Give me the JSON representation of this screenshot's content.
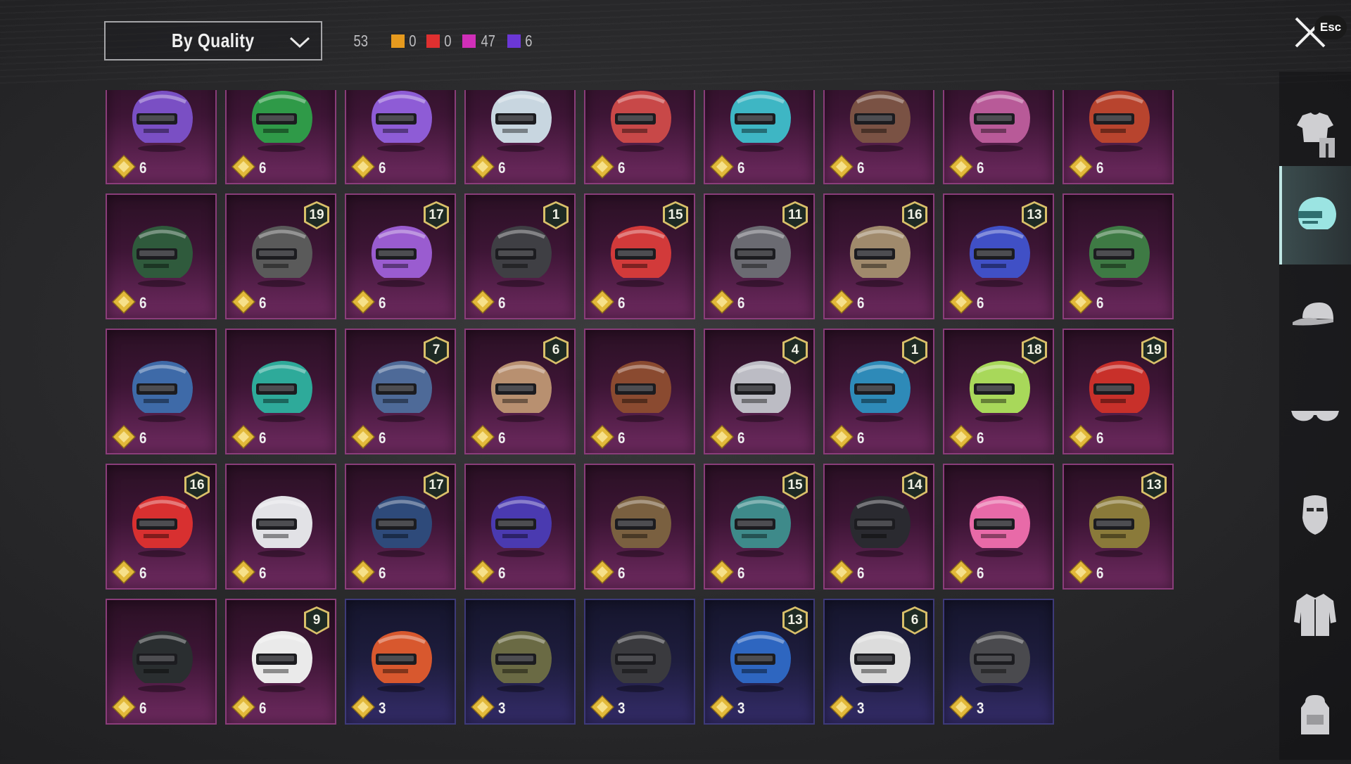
{
  "sort": {
    "label": "By Quality"
  },
  "counts": {
    "total": "53",
    "items": [
      {
        "color": "#e69a1e",
        "value": "0"
      },
      {
        "color": "#e03030",
        "value": "0"
      },
      {
        "color": "#d02fb8",
        "value": "47"
      },
      {
        "color": "#6b37d6",
        "value": "6"
      }
    ]
  },
  "close": {
    "esc_label": "Esc"
  },
  "sidebar": {
    "categories": [
      {
        "icon": "outfit-icon",
        "active": false
      },
      {
        "icon": "helmet-icon",
        "active": true
      },
      {
        "icon": "cap-icon",
        "active": false
      },
      {
        "icon": "glasses-icon",
        "active": false
      },
      {
        "icon": "mask-icon",
        "active": false
      },
      {
        "icon": "jacket-icon",
        "active": false
      },
      {
        "icon": "backpack-icon",
        "active": false
      }
    ]
  },
  "items": [
    {
      "ammo": "6",
      "level": "",
      "quality": "purple",
      "color": "#7a4fc4"
    },
    {
      "ammo": "6",
      "level": "",
      "quality": "purple",
      "color": "#2f9a48"
    },
    {
      "ammo": "6",
      "level": "",
      "quality": "purple",
      "color": "#8e5cd6"
    },
    {
      "ammo": "6",
      "level": "",
      "quality": "purple",
      "color": "#c8d6e0"
    },
    {
      "ammo": "6",
      "level": "",
      "quality": "purple",
      "color": "#c84848"
    },
    {
      "ammo": "6",
      "level": "",
      "quality": "purple",
      "color": "#3eb6c4"
    },
    {
      "ammo": "6",
      "level": "",
      "quality": "purple",
      "color": "#7a5244"
    },
    {
      "ammo": "6",
      "level": "",
      "quality": "purple",
      "color": "#b85a98"
    },
    {
      "ammo": "6",
      "level": "",
      "quality": "purple",
      "color": "#b8442e"
    },
    {
      "ammo": "6",
      "level": "",
      "quality": "purple",
      "color": "#2f5a3c"
    },
    {
      "ammo": "6",
      "level": "19",
      "quality": "purple",
      "color": "#5a5a5a"
    },
    {
      "ammo": "6",
      "level": "17",
      "quality": "purple",
      "color": "#9a5cd0"
    },
    {
      "ammo": "6",
      "level": "1",
      "quality": "purple",
      "color": "#3f3f44"
    },
    {
      "ammo": "6",
      "level": "15",
      "quality": "purple",
      "color": "#d23a3a"
    },
    {
      "ammo": "6",
      "level": "11",
      "quality": "purple",
      "color": "#6b6b72"
    },
    {
      "ammo": "6",
      "level": "16",
      "quality": "purple",
      "color": "#a08a6c"
    },
    {
      "ammo": "6",
      "level": "13",
      "quality": "purple",
      "color": "#4050c6"
    },
    {
      "ammo": "6",
      "level": "",
      "quality": "purple",
      "color": "#3e7a44"
    },
    {
      "ammo": "6",
      "level": "",
      "quality": "purple",
      "color": "#3e6aa8"
    },
    {
      "ammo": "6",
      "level": "",
      "quality": "purple",
      "color": "#2eaa9a"
    },
    {
      "ammo": "6",
      "level": "7",
      "quality": "purple",
      "color": "#4e6a98"
    },
    {
      "ammo": "6",
      "level": "6",
      "quality": "purple",
      "color": "#b89070"
    },
    {
      "ammo": "6",
      "level": "",
      "quality": "purple",
      "color": "#8a4a30"
    },
    {
      "ammo": "6",
      "level": "4",
      "quality": "purple",
      "color": "#bcbcc4"
    },
    {
      "ammo": "6",
      "level": "1",
      "quality": "purple",
      "color": "#2e8ab8"
    },
    {
      "ammo": "6",
      "level": "18",
      "quality": "purple",
      "color": "#a8d85a"
    },
    {
      "ammo": "6",
      "level": "19",
      "quality": "purple",
      "color": "#c8302a"
    },
    {
      "ammo": "6",
      "level": "16",
      "quality": "purple",
      "color": "#d83030"
    },
    {
      "ammo": "6",
      "level": "",
      "quality": "purple",
      "color": "#e2e2e6"
    },
    {
      "ammo": "6",
      "level": "17",
      "quality": "purple",
      "color": "#2e4a7a"
    },
    {
      "ammo": "6",
      "level": "",
      "quality": "purple",
      "color": "#4a3ab0"
    },
    {
      "ammo": "6",
      "level": "",
      "quality": "purple",
      "color": "#7a6040"
    },
    {
      "ammo": "6",
      "level": "15",
      "quality": "purple",
      "color": "#3e8a8a"
    },
    {
      "ammo": "6",
      "level": "14",
      "quality": "purple",
      "color": "#2a2a30"
    },
    {
      "ammo": "6",
      "level": "",
      "quality": "purple",
      "color": "#e86aa8"
    },
    {
      "ammo": "6",
      "level": "13",
      "quality": "purple",
      "color": "#8a7a3a"
    },
    {
      "ammo": "6",
      "level": "",
      "quality": "purple",
      "color": "#2a2e30"
    },
    {
      "ammo": "6",
      "level": "9",
      "quality": "purple",
      "color": "#eaeaea"
    },
    {
      "ammo": "3",
      "level": "",
      "quality": "blue",
      "color": "#d8582e"
    },
    {
      "ammo": "3",
      "level": "",
      "quality": "blue",
      "color": "#6a6a44"
    },
    {
      "ammo": "3",
      "level": "",
      "quality": "blue",
      "color": "#3a3a3e"
    },
    {
      "ammo": "3",
      "level": "13",
      "quality": "blue",
      "color": "#2e66c0"
    },
    {
      "ammo": "3",
      "level": "6",
      "quality": "blue",
      "color": "#dcdcdc"
    },
    {
      "ammo": "3",
      "level": "",
      "quality": "blue",
      "color": "#4a4a4e"
    }
  ]
}
